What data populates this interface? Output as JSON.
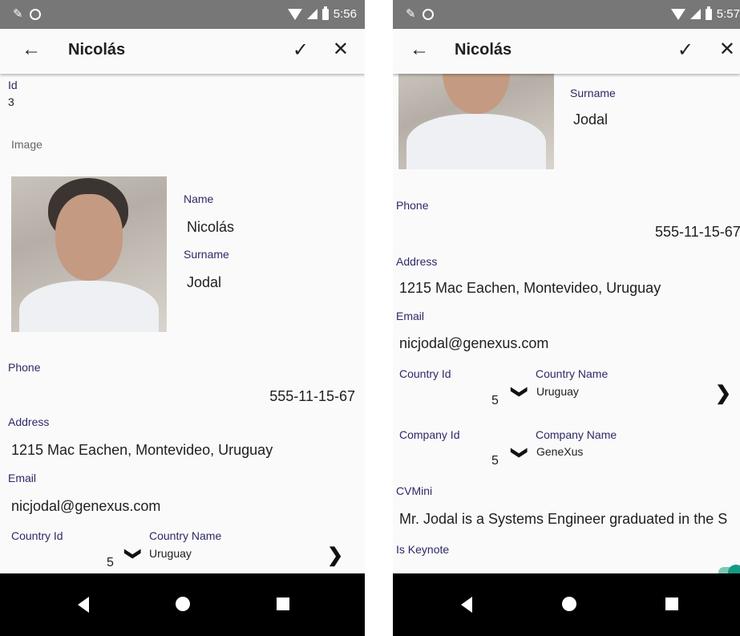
{
  "status": {
    "time_left": "5:56",
    "time_right": "5:57"
  },
  "toolbar": {
    "back_icon": "←",
    "title": "Nicolás",
    "check_icon": "✓",
    "close_icon": "✕"
  },
  "record": {
    "id_label": "Id",
    "id_value": "3",
    "image_label": "Image",
    "name_label": "Name",
    "name_value": "Nicolás",
    "surname_label": "Surname",
    "surname_value": "Jodal",
    "phone_label": "Phone",
    "phone_value": "555-11-15-67",
    "address_label": "Address",
    "address_value": "1215 Mac Eachen, Montevideo, Uruguay",
    "email_label": "Email",
    "email_value": "nicjodal@genexus.com",
    "country_id_label": "Country Id",
    "country_id_value": "5",
    "country_name_label": "Country Name",
    "country_name_value": "Uruguay",
    "company_id_label": "Company Id",
    "company_id_value": "5",
    "company_name_label": "Company Name",
    "company_name_value": "GeneXus",
    "cvmini_label": "CVMini",
    "cvmini_value": "Mr. Jodal is a Systems Engineer graduated in the S",
    "keynote_label": "Is Keynote",
    "keynote_on": true
  },
  "icons": {
    "chevron_down": "❯",
    "chevron_right": "❯"
  },
  "colors": {
    "label": "#2d2a66",
    "toggle": "#159a85",
    "statusbar": "#777777"
  }
}
